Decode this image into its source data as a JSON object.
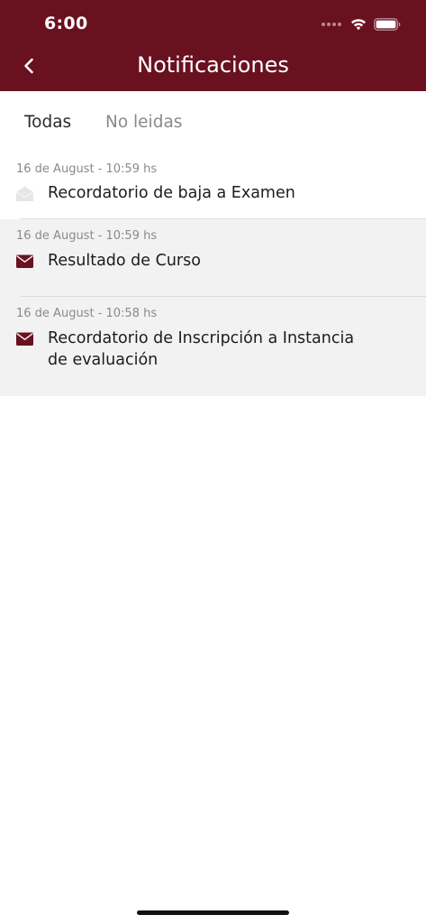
{
  "status_bar": {
    "time": "6:00"
  },
  "header": {
    "title": "Notificaciones",
    "back_icon": "chevron-left-icon"
  },
  "tabs": [
    {
      "label": "Todas",
      "selected": true
    },
    {
      "label": "No leidas",
      "selected": false
    }
  ],
  "notifications": [
    {
      "date": "16 de August - 10:59 hs",
      "title": "Recordatorio de baja a Examen",
      "read": true,
      "icon": "envelope-open-icon"
    },
    {
      "date": "16 de August - 10:59 hs",
      "title": "Resultado de Curso",
      "read": false,
      "icon": "envelope-icon"
    },
    {
      "date": "16 de August - 10:58 hs",
      "title": "Recordatorio de Inscripción a Instancia de evaluación",
      "read": false,
      "icon": "envelope-icon"
    }
  ],
  "colors": {
    "brand": "#6a1120",
    "unread_bg": "#f2f2f2",
    "read_icon": "#e6e6e6"
  }
}
